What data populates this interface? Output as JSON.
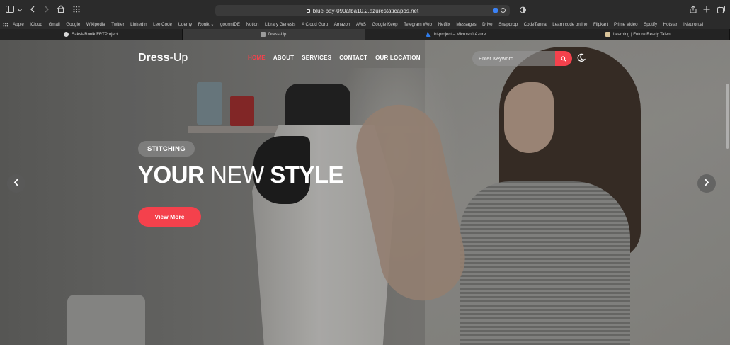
{
  "browser": {
    "url": "blue-bay-090afba10.2.azurestaticapps.net",
    "bookmarks": [
      "Apple",
      "iCloud",
      "Gmail",
      "Google",
      "Wikipedia",
      "Twitter",
      "LinkedIn",
      "LeetCode",
      "Udemy",
      "Ronik",
      "goormIDE",
      "Notion",
      "Library Genesis",
      "A Cloud Guru",
      "Amazon",
      "AWS",
      "Google Keep",
      "Telegram Web",
      "Netflix",
      "Messages",
      "Drive",
      "Snapdrop",
      "CodeTantra",
      "Learn code online",
      "Flipkart",
      "Prime Video",
      "Spotify",
      "Hotstar",
      "iNeuron.ai"
    ],
    "tabs": [
      {
        "title": "SaksiaRonik/FRTProject",
        "active": false,
        "fav_color": "#d8d8d8"
      },
      {
        "title": "Dress-Up",
        "active": true,
        "fav_color": "#9a9a9a"
      },
      {
        "title": "frt-project – Microsoft Azure",
        "active": false,
        "fav_color": "#2f7be8"
      },
      {
        "title": "Learning | Future Ready Talent",
        "active": false,
        "fav_color": "#d9c49a"
      }
    ]
  },
  "site": {
    "logo_bold": "Dress",
    "logo_light": "-Up",
    "nav": [
      {
        "label": "HOME",
        "active": true
      },
      {
        "label": "ABOUT",
        "active": false
      },
      {
        "label": "SERVICES",
        "active": false
      },
      {
        "label": "CONTACT",
        "active": false
      },
      {
        "label": "OUR LOCATION",
        "active": false
      }
    ],
    "search_placeholder": "Enter Keyword..."
  },
  "hero": {
    "badge": "STITCHING",
    "headline_part1": "YOUR",
    "headline_part2": "NEW",
    "headline_part3": "STYLE",
    "cta_label": "View More"
  },
  "colors": {
    "accent": "#f4414c",
    "chrome_bg": "#2b2b2b"
  }
}
